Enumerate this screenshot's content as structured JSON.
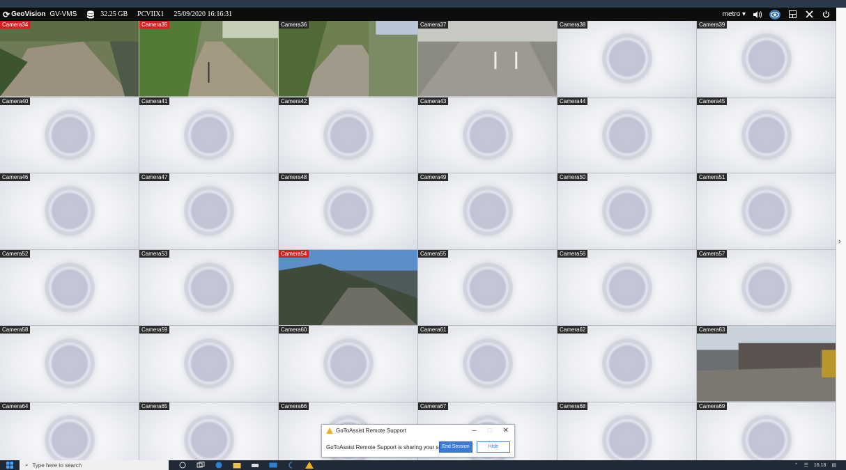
{
  "app": {
    "brand": "GeoVision",
    "product": "GV-VMS",
    "storage": "32.25 GB",
    "host": "PCVIIX1",
    "datetime": "25/09/2020 16:16:31",
    "layout_label": "metro",
    "icons": [
      "database-icon",
      "volume-icon",
      "eye-icon",
      "layout-icon",
      "tools-icon",
      "power-icon"
    ],
    "accent": "#3a76b8"
  },
  "cameras": [
    {
      "label": "Camera34",
      "alarm": true,
      "live": true
    },
    {
      "label": "Camera35",
      "alarm": true,
      "live": true
    },
    {
      "label": "Camera36",
      "alarm": false,
      "live": true
    },
    {
      "label": "Camera37",
      "alarm": false,
      "live": true
    },
    {
      "label": "Camera38",
      "alarm": false,
      "live": false
    },
    {
      "label": "Camera39",
      "alarm": false,
      "live": false
    },
    {
      "label": "Camera40",
      "alarm": false,
      "live": false
    },
    {
      "label": "Camera41",
      "alarm": false,
      "live": false
    },
    {
      "label": "Camera42",
      "alarm": false,
      "live": false
    },
    {
      "label": "Camera43",
      "alarm": false,
      "live": false
    },
    {
      "label": "Camera44",
      "alarm": false,
      "live": false
    },
    {
      "label": "Camera45",
      "alarm": false,
      "live": false
    },
    {
      "label": "Camera46",
      "alarm": false,
      "live": false
    },
    {
      "label": "Camera47",
      "alarm": false,
      "live": false
    },
    {
      "label": "Camera48",
      "alarm": false,
      "live": false
    },
    {
      "label": "Camera49",
      "alarm": false,
      "live": false
    },
    {
      "label": "Camera50",
      "alarm": false,
      "live": false
    },
    {
      "label": "Camera51",
      "alarm": false,
      "live": false
    },
    {
      "label": "Camera52",
      "alarm": false,
      "live": false
    },
    {
      "label": "Camera53",
      "alarm": false,
      "live": false
    },
    {
      "label": "Camera54",
      "alarm": true,
      "live": true
    },
    {
      "label": "Camera55",
      "alarm": false,
      "live": false
    },
    {
      "label": "Camera56",
      "alarm": false,
      "live": false
    },
    {
      "label": "Camera57",
      "alarm": false,
      "live": false
    },
    {
      "label": "Camera58",
      "alarm": false,
      "live": false
    },
    {
      "label": "Camera59",
      "alarm": false,
      "live": false
    },
    {
      "label": "Camera60",
      "alarm": false,
      "live": false
    },
    {
      "label": "Camera61",
      "alarm": false,
      "live": false
    },
    {
      "label": "Camera62",
      "alarm": false,
      "live": false
    },
    {
      "label": "Camera63",
      "alarm": false,
      "live": true
    },
    {
      "label": "Camera64",
      "alarm": false,
      "live": false
    },
    {
      "label": "Camera65",
      "alarm": false,
      "live": false
    },
    {
      "label": "Camera66",
      "alarm": false,
      "live": false
    },
    {
      "label": "Camera67",
      "alarm": false,
      "live": false
    },
    {
      "label": "Camera68",
      "alarm": false,
      "live": false
    },
    {
      "label": "Camera69",
      "alarm": false,
      "live": false
    }
  ],
  "remote_support": {
    "title": "GoToAssist Remote Support",
    "message": "GoToAssist Remote Support is sharing your screen.",
    "end_label": "End Session",
    "hide_label": "Hide"
  },
  "taskbar": {
    "search_placeholder": "Type here to search",
    "clock": "16:18"
  }
}
